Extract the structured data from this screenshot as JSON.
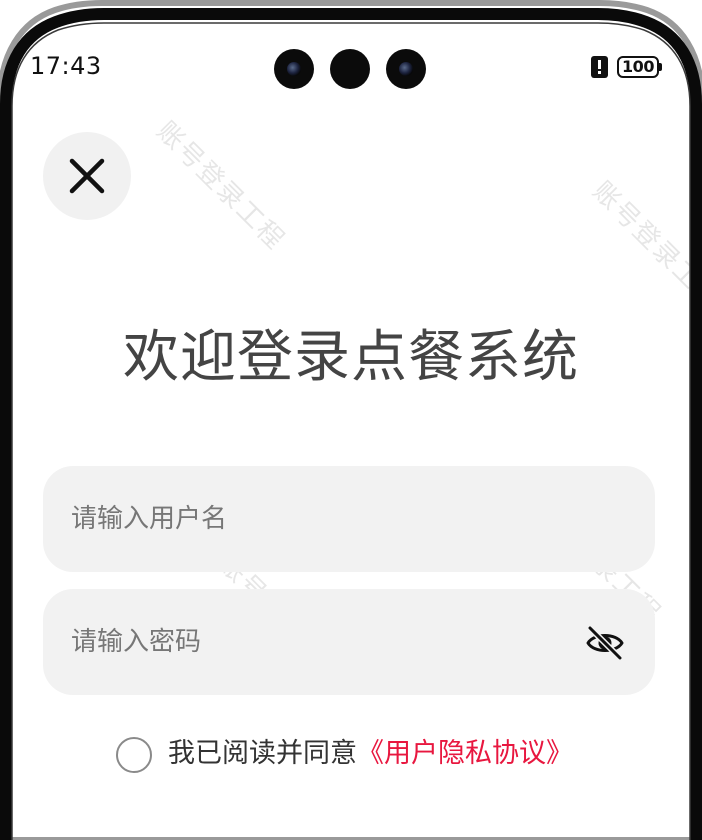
{
  "status_bar": {
    "time": "17:43",
    "battery": "100"
  },
  "icons": {
    "close": "close-icon",
    "password_toggle": "eye-off-icon",
    "alert": "alert-icon",
    "battery": "battery-icon"
  },
  "title": "欢迎登录点餐系统",
  "username_field": {
    "placeholder": "请输入用户名",
    "value": ""
  },
  "password_field": {
    "placeholder": "请输入密码",
    "value": ""
  },
  "agreement": {
    "checked": false,
    "text": "我已阅读并同意",
    "link_text": "《用户隐私协议》"
  },
  "watermark": "账号登录工程",
  "colors": {
    "link": "#e8173f",
    "title": "#444444",
    "field_background": "#f2f2f2",
    "close_button_background": "#f1f1f1"
  }
}
